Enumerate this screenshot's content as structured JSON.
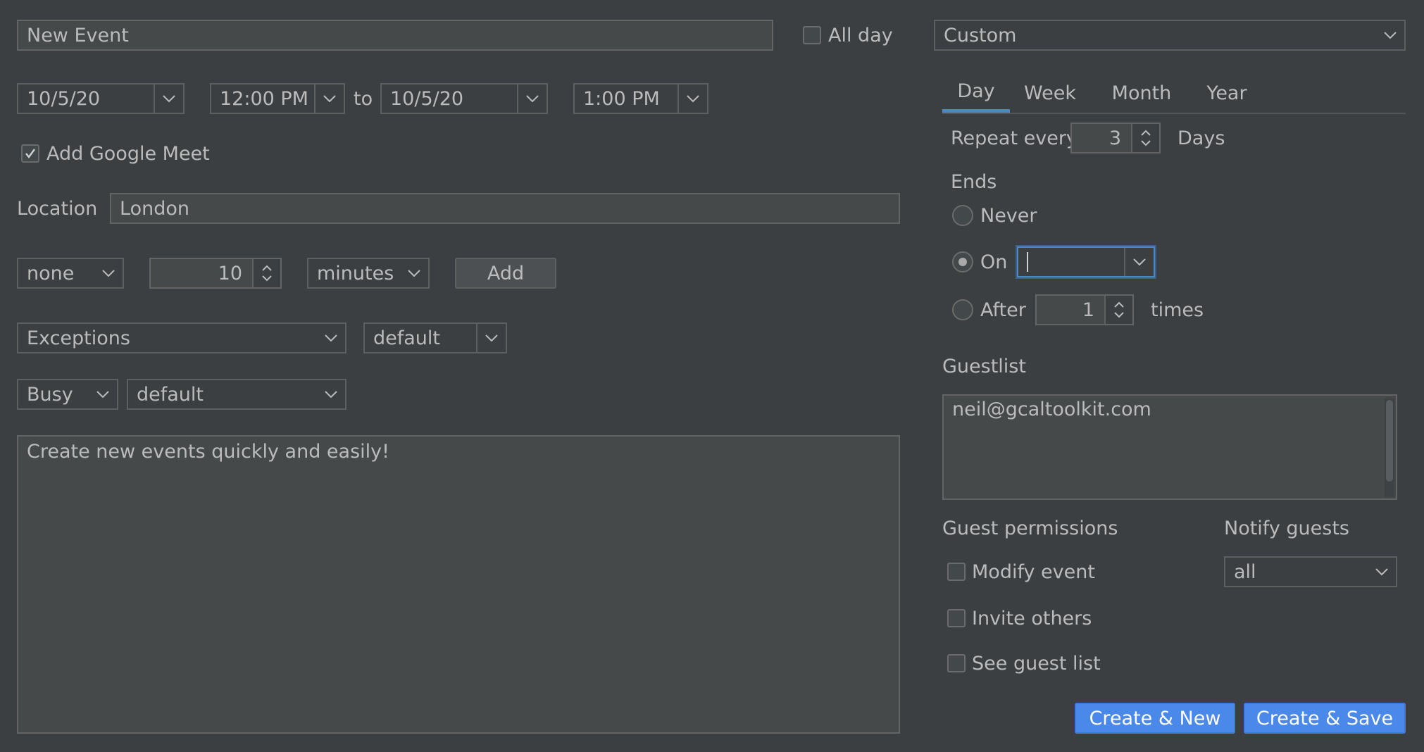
{
  "event": {
    "title": "New Event",
    "all_day_label": "All day",
    "recurrence_preset": "Custom"
  },
  "datetime": {
    "start_date": "10/5/20",
    "start_time": "12:00 PM",
    "to_label": "to",
    "end_date": "10/5/20",
    "end_time": "1:00 PM"
  },
  "meet": {
    "label": "Add Google Meet",
    "checked": true
  },
  "location": {
    "label": "Location",
    "value": "London"
  },
  "reminder": {
    "type": "none",
    "amount": "10",
    "unit": "minutes",
    "add_label": "Add"
  },
  "visibility": {
    "exceptions": "Exceptions",
    "default1": "default"
  },
  "availability": {
    "busy": "Busy",
    "default2": "default"
  },
  "description": "Create new events quickly and easily!",
  "recurrence": {
    "tabs": [
      "Day",
      "Week",
      "Month",
      "Year"
    ],
    "active_tab": "Day",
    "repeat_every_label": "Repeat every",
    "repeat_every_value": "3",
    "repeat_unit": "Days",
    "ends_label": "Ends",
    "never_label": "Never",
    "on_label": "On",
    "on_value": "",
    "after_label": "After",
    "after_value": "1",
    "times_label": "times"
  },
  "guests": {
    "label": "Guestlist",
    "value": "neil@gcaltoolkit.com",
    "permissions_label": "Guest permissions",
    "modify_label": "Modify event",
    "invite_label": "Invite others",
    "see_list_label": "See guest list",
    "notify_label": "Notify guests",
    "notify_value": "all"
  },
  "actions": {
    "create_new": "Create & New",
    "create_save": "Create & Save"
  },
  "colors": {
    "background": "#3c3f41",
    "accent": "#4a88e9",
    "tab_underline": "#4a88c7"
  }
}
